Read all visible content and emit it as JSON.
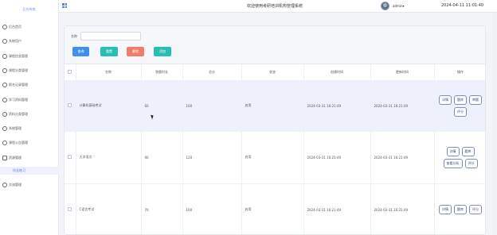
{
  "brand": "后台系统",
  "topbar": {
    "title": "欢迎使用考研培训机构管理系统",
    "user": "admin",
    "datetime": "2024-04-11 11:01:40"
  },
  "sidebar": {
    "items": [
      {
        "label": "后台首页",
        "icon": "home-icon"
      },
      {
        "label": "系统用户",
        "icon": "user-icon"
      },
      {
        "label": "课程信息管理",
        "icon": "course-icon"
      },
      {
        "label": "课程分类管理",
        "icon": "category-icon"
      },
      {
        "label": "报名记录管理",
        "icon": "record-icon"
      },
      {
        "label": "学习资料管理",
        "icon": "book-icon"
      },
      {
        "label": "资料分类管理",
        "icon": "folder-icon"
      },
      {
        "label": "系统管理",
        "icon": "settings-icon"
      },
      {
        "label": "课程公告管理",
        "icon": "notice-icon"
      },
      {
        "label": "资源管理",
        "icon": "people-icon"
      },
      {
        "label": "作业练习",
        "icon": ""
      },
      {
        "label": "交流管理",
        "icon": "list-icon"
      }
    ]
  },
  "filter": {
    "label": "名称",
    "placeholder": "",
    "search_label": "查询",
    "reset_label": "重置",
    "delete_label": "删除",
    "add_label": "添加"
  },
  "table": {
    "headers": [
      "",
      "名称",
      "答题时长",
      "总分",
      "状态",
      "创建时间",
      "更新时间",
      "操作"
    ],
    "rows": [
      {
        "name": "计算机基础考试",
        "duration": "60",
        "total": "100",
        "status": "启用",
        "created": "2024-03-31 16:21:49",
        "updated": "2024-03-31 16:21:49",
        "ops": [
          "详情",
          "题库",
          "审题",
          "评分"
        ]
      },
      {
        "name": "大学语文",
        "duration": "90",
        "total": "120",
        "status": "启用",
        "created": "2024-03-31 16:21:49",
        "updated": "2024-03-31 16:21:49",
        "ops": [
          "详情",
          "题库",
          "查看分析",
          "评分"
        ]
      },
      {
        "name": "C语言考试",
        "duration": "70",
        "total": "100",
        "status": "启用",
        "created": "2024-03-31 16:21:49",
        "updated": "2024-03-31 16:21:49",
        "ops": [
          "详情",
          "题库",
          "评分"
        ]
      }
    ]
  }
}
